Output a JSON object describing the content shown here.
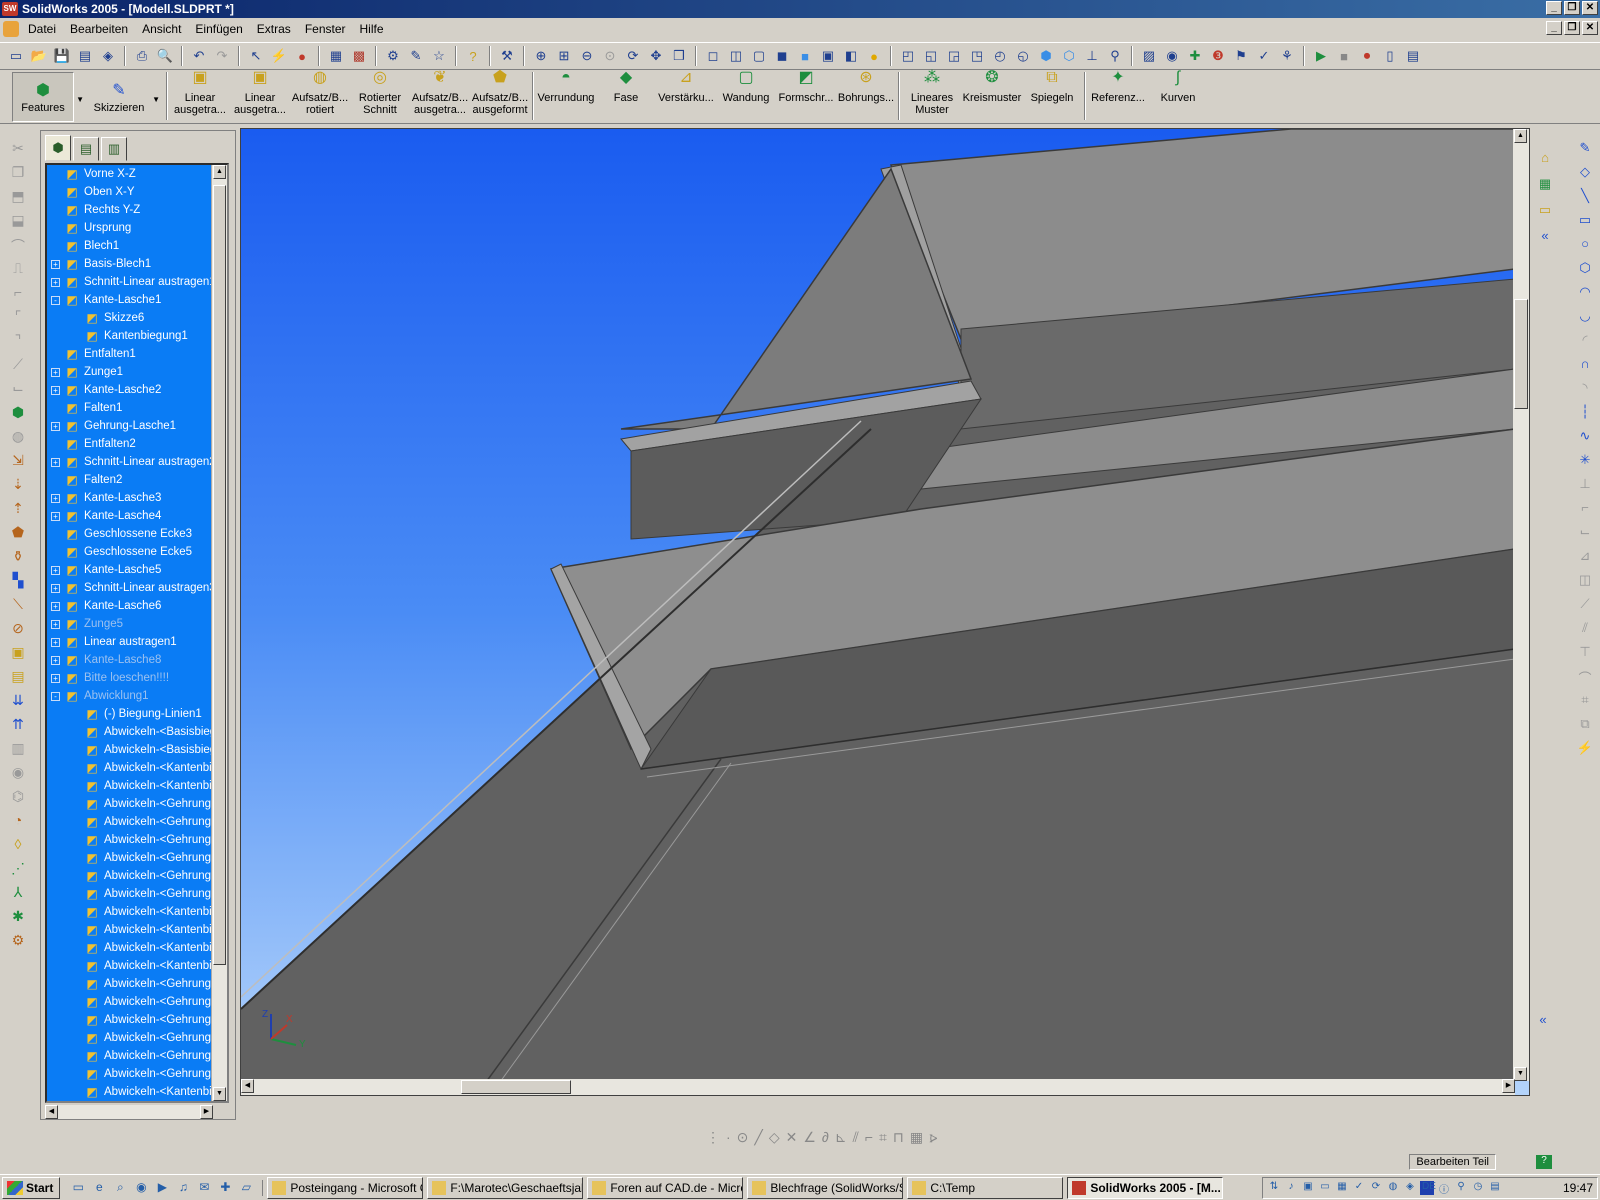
{
  "window": {
    "title": "SolidWorks 2005 - [Modell.SLDPRT *]",
    "app_icon": "SW"
  },
  "window_buttons": [
    "_",
    "❐",
    "✕"
  ],
  "menu": [
    "Datei",
    "Bearbeiten",
    "Ansicht",
    "Einfügen",
    "Extras",
    "Fenster",
    "Hilfe"
  ],
  "command_manager": {
    "tabs": [
      {
        "label": "Features",
        "icon": "features-icon"
      },
      {
        "label": "Skizzieren",
        "icon": "sketch-icon"
      }
    ],
    "buttons": [
      {
        "l1": "Linear",
        "l2": "ausgetra..."
      },
      {
        "l1": "Linear",
        "l2": "ausgetra..."
      },
      {
        "l1": "Aufsatz/B...",
        "l2": "rotiert"
      },
      {
        "l1": "Rotierter",
        "l2": "Schnitt"
      },
      {
        "l1": "Aufsatz/B...",
        "l2": "ausgetra..."
      },
      {
        "l1": "Aufsatz/B...",
        "l2": "ausgeformt"
      },
      {
        "l1": "Verrundung",
        "l2": ""
      },
      {
        "l1": "Fase",
        "l2": ""
      },
      {
        "l1": "Verstärku...",
        "l2": ""
      },
      {
        "l1": "Wandung",
        "l2": ""
      },
      {
        "l1": "Formschr...",
        "l2": ""
      },
      {
        "l1": "Bohrungs...",
        "l2": ""
      },
      {
        "l1": "Lineares",
        "l2": "Muster"
      },
      {
        "l1": "Kreismuster",
        "l2": ""
      },
      {
        "l1": "Spiegeln",
        "l2": ""
      },
      {
        "l1": "Referenz...",
        "l2": ""
      },
      {
        "l1": "Kurven",
        "l2": ""
      }
    ]
  },
  "feature_tree": {
    "rows": [
      {
        "label": "Vorne X-Z",
        "exp": "",
        "indent": 0,
        "dim": false
      },
      {
        "label": "Oben X-Y",
        "exp": "",
        "indent": 0,
        "dim": false
      },
      {
        "label": "Rechts Y-Z",
        "exp": "",
        "indent": 0,
        "dim": false
      },
      {
        "label": "Ursprung",
        "exp": "",
        "indent": 0,
        "dim": false
      },
      {
        "label": "Blech1",
        "exp": "",
        "indent": 0,
        "dim": false
      },
      {
        "label": "Basis-Blech1",
        "exp": "+",
        "indent": 0,
        "dim": false
      },
      {
        "label": "Schnitt-Linear austragen1",
        "exp": "+",
        "indent": 0,
        "dim": false
      },
      {
        "label": "Kante-Lasche1",
        "exp": "-",
        "indent": 0,
        "dim": false
      },
      {
        "label": "Skizze6",
        "exp": "",
        "indent": 1,
        "dim": false
      },
      {
        "label": "Kantenbiegung1",
        "exp": "",
        "indent": 1,
        "dim": false
      },
      {
        "label": "Entfalten1",
        "exp": "",
        "indent": 0,
        "dim": false
      },
      {
        "label": "Zunge1",
        "exp": "+",
        "indent": 0,
        "dim": false
      },
      {
        "label": "Kante-Lasche2",
        "exp": "+",
        "indent": 0,
        "dim": false
      },
      {
        "label": "Falten1",
        "exp": "",
        "indent": 0,
        "dim": false
      },
      {
        "label": "Gehrung-Lasche1",
        "exp": "+",
        "indent": 0,
        "dim": false
      },
      {
        "label": "Entfalten2",
        "exp": "",
        "indent": 0,
        "dim": false
      },
      {
        "label": "Schnitt-Linear austragen2",
        "exp": "+",
        "indent": 0,
        "dim": false
      },
      {
        "label": "Falten2",
        "exp": "",
        "indent": 0,
        "dim": false
      },
      {
        "label": "Kante-Lasche3",
        "exp": "+",
        "indent": 0,
        "dim": false
      },
      {
        "label": "Kante-Lasche4",
        "exp": "+",
        "indent": 0,
        "dim": false
      },
      {
        "label": "Geschlossene Ecke3",
        "exp": "",
        "indent": 0,
        "dim": false
      },
      {
        "label": "Geschlossene Ecke5",
        "exp": "",
        "indent": 0,
        "dim": false
      },
      {
        "label": "Kante-Lasche5",
        "exp": "+",
        "indent": 0,
        "dim": false
      },
      {
        "label": "Schnitt-Linear austragen3",
        "exp": "+",
        "indent": 0,
        "dim": false
      },
      {
        "label": "Kante-Lasche6",
        "exp": "+",
        "indent": 0,
        "dim": false
      },
      {
        "label": "Zunge5",
        "exp": "+",
        "indent": 0,
        "dim": true
      },
      {
        "label": "Linear austragen1",
        "exp": "+",
        "indent": 0,
        "dim": false
      },
      {
        "label": "Kante-Lasche8",
        "exp": "+",
        "indent": 0,
        "dim": true
      },
      {
        "label": "Bitte loeschen!!!!",
        "exp": "+",
        "indent": 0,
        "dim": true
      },
      {
        "label": "Abwicklung1",
        "exp": "-",
        "indent": 0,
        "dim": true
      },
      {
        "label": "(-) Biegung-Linien1",
        "exp": "",
        "indent": 1,
        "dim": false
      },
      {
        "label": "Abwickeln-<Basisbiegung",
        "exp": "",
        "indent": 1,
        "dim": false
      },
      {
        "label": "Abwickeln-<Basisbiegung",
        "exp": "",
        "indent": 1,
        "dim": false
      },
      {
        "label": "Abwickeln-<Kantenbieg",
        "exp": "",
        "indent": 1,
        "dim": false
      },
      {
        "label": "Abwickeln-<Kantenbieg",
        "exp": "",
        "indent": 1,
        "dim": false
      },
      {
        "label": "Abwickeln-<Gehrungsb",
        "exp": "",
        "indent": 1,
        "dim": false
      },
      {
        "label": "Abwickeln-<Gehrungsb",
        "exp": "",
        "indent": 1,
        "dim": false
      },
      {
        "label": "Abwickeln-<Gehrungsb",
        "exp": "",
        "indent": 1,
        "dim": false
      },
      {
        "label": "Abwickeln-<Gehrungsb",
        "exp": "",
        "indent": 1,
        "dim": false
      },
      {
        "label": "Abwickeln-<Gehrungsb",
        "exp": "",
        "indent": 1,
        "dim": false
      },
      {
        "label": "Abwickeln-<Gehrungsb",
        "exp": "",
        "indent": 1,
        "dim": false
      },
      {
        "label": "Abwickeln-<Kantenbieg",
        "exp": "",
        "indent": 1,
        "dim": false
      },
      {
        "label": "Abwickeln-<Kantenbieg",
        "exp": "",
        "indent": 1,
        "dim": false
      },
      {
        "label": "Abwickeln-<Kantenbieg",
        "exp": "",
        "indent": 1,
        "dim": false
      },
      {
        "label": "Abwickeln-<Kantenbieg",
        "exp": "",
        "indent": 1,
        "dim": false
      },
      {
        "label": "Abwickeln-<Gehrungsb",
        "exp": "",
        "indent": 1,
        "dim": false
      },
      {
        "label": "Abwickeln-<Gehrungsb",
        "exp": "",
        "indent": 1,
        "dim": false
      },
      {
        "label": "Abwickeln-<Gehrungsb",
        "exp": "",
        "indent": 1,
        "dim": false
      },
      {
        "label": "Abwickeln-<Gehrungsb",
        "exp": "",
        "indent": 1,
        "dim": false
      },
      {
        "label": "Abwickeln-<Gehrungsb",
        "exp": "",
        "indent": 1,
        "dim": false
      },
      {
        "label": "Abwickeln-<Gehrungsb",
        "exp": "",
        "indent": 1,
        "dim": false
      },
      {
        "label": "Abwickeln-<Kantenbieg",
        "exp": "",
        "indent": 1,
        "dim": false
      }
    ]
  },
  "triad": {
    "x": "X",
    "y": "Y",
    "z": "Z"
  },
  "status": {
    "mode": "Bearbeiten Teil",
    "help": "?"
  },
  "taskbar": {
    "start": "Start",
    "tasks": [
      {
        "label": "Posteingang - Microsoft O...",
        "active": false
      },
      {
        "label": "F:\\Marotec\\Geschaeftsjah...",
        "active": false
      },
      {
        "label": "Foren auf CAD.de - Micros...",
        "active": false
      },
      {
        "label": "Blechfrage (SolidWorks/S...",
        "active": false
      },
      {
        "label": "C:\\Temp",
        "active": false
      },
      {
        "label": "SolidWorks 2005 - [M...",
        "active": true
      }
    ],
    "tray_lang": "DE",
    "clock": "19:47"
  },
  "colors": {
    "viewport_top": "#1a5cf0",
    "viewport_bottom": "#b4d4fb",
    "tree_bg": "#0a7cf5",
    "part_gray": "#8c8c8c"
  }
}
